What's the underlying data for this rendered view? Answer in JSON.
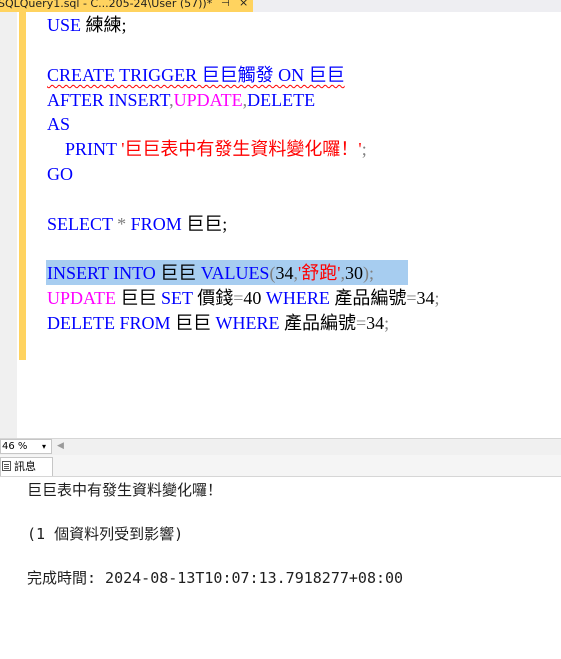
{
  "tab": {
    "title": "SQLQuery1.sql - C...205-24\\User (57))*",
    "pin": "⊣",
    "close": "×"
  },
  "editor": {
    "l1": {
      "a": "USE",
      "b": " 練練;"
    },
    "l3": {
      "a": "CREATE TRIGGER 巨巨觸發 ON 巨巨"
    },
    "l4": {
      "a": "AFTER",
      "b": " ",
      "c": "INSERT",
      "d": ",",
      "e": "UPDATE",
      "f": ",",
      "g": "DELETE"
    },
    "l5": {
      "a": "AS"
    },
    "l6": {
      "a": "    ",
      "b": "PRINT",
      "c": " ",
      "d": "'巨巨表中有發生資料變化囉！'",
      "e": ";"
    },
    "l7": {
      "a": "GO"
    },
    "l9": {
      "a": "SELECT",
      "b": " ",
      "c": "*",
      "d": " ",
      "e": "FROM",
      "f": " 巨巨;"
    },
    "l11": {
      "a": "INSERT",
      "b": " ",
      "c": "INTO",
      "d": " 巨巨 ",
      "e": "VALUES",
      "f": "(",
      "g": "34",
      "h": ",",
      "i": "'舒跑'",
      "j": ",",
      "k": "30",
      "l": ");"
    },
    "l12": {
      "a": "UPDATE",
      "b": " 巨巨 ",
      "c": "SET",
      "d": " 價錢",
      "e": "=",
      "f": "40 ",
      "g": "WHERE",
      "h": " 產品編號",
      "i": "=",
      "j": "34",
      "k": ";"
    },
    "l13": {
      "a": "DELETE",
      "b": " ",
      "c": "FROM",
      "d": " 巨巨 ",
      "e": "WHERE",
      "f": " 產品編號",
      "g": "=",
      "h": "34",
      "i": ";"
    }
  },
  "zoom": {
    "value": "46 %",
    "arrow": "▾"
  },
  "scroll": {
    "left_arrow": "◀"
  },
  "results": {
    "messages_tab_label": "訊息"
  },
  "messages": {
    "line1": "巨巨表中有發生資料變化囉！",
    "line2": "(1 個資料列受到影響)",
    "line3": "完成時間: 2024-08-13T10:07:13.7918277+08:00"
  },
  "colors": {
    "keyword": "#0000ff",
    "function": "#ff00ff",
    "string": "#ff0000",
    "operator": "#808080",
    "selection": "#a7cdf0",
    "tab": "#ffd35f"
  }
}
